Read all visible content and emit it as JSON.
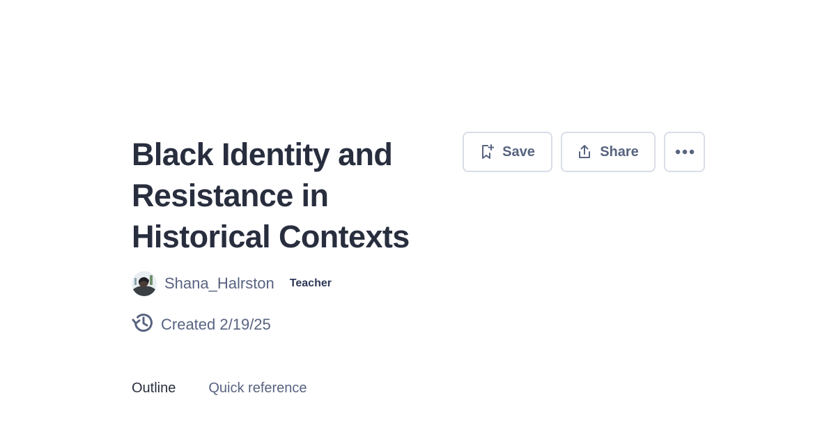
{
  "set": {
    "title": "Black Identity and Resistance in Historical Contexts"
  },
  "toolbar": {
    "save_label": "Save",
    "share_label": "Share",
    "save_icon": "bookmark-plus-icon",
    "share_icon": "share-icon",
    "more_icon": "more-horizontal-icon"
  },
  "author": {
    "name": "Shana_Halrston",
    "role": "Teacher"
  },
  "meta": {
    "created": "Created 2/19/25",
    "created_icon": "history-icon"
  },
  "tabs": [
    {
      "label": "Outline",
      "active": true
    },
    {
      "label": "Quick reference",
      "active": false
    }
  ],
  "colors": {
    "text_primary": "#282e3e",
    "text_secondary": "#586380",
    "button_border": "#d9dde8"
  }
}
